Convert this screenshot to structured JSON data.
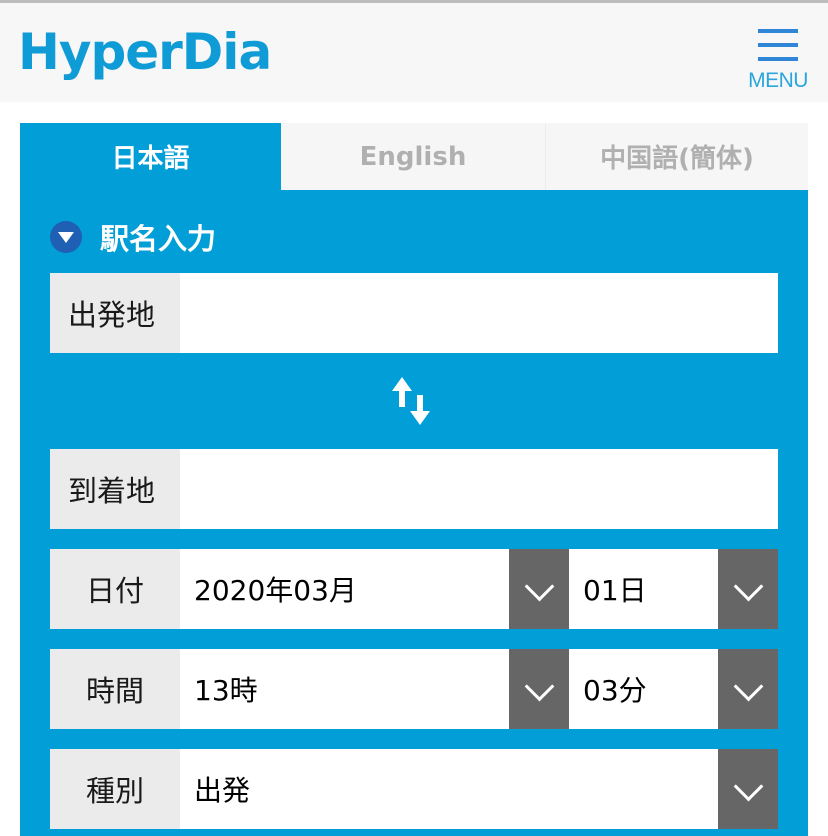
{
  "header": {
    "logo": "HyperDia",
    "menu_label": "MENU"
  },
  "tabs": [
    {
      "label": "日本語",
      "active": true
    },
    {
      "label": "English",
      "active": false
    },
    {
      "label": "中国語(簡体)",
      "active": false
    }
  ],
  "section": {
    "title": "駅名入力",
    "icon": "triangle-down-circle-icon"
  },
  "form": {
    "departure": {
      "label": "出発地",
      "value": "",
      "placeholder": ""
    },
    "swap_icon": "swap-arrows-icon",
    "arrival": {
      "label": "到着地",
      "value": "",
      "placeholder": ""
    },
    "date": {
      "label": "日付",
      "month_value": "2020年03月",
      "day_value": "01日"
    },
    "time": {
      "label": "時間",
      "hour_value": "13時",
      "minute_value": "03分"
    },
    "type": {
      "label": "種別",
      "value": "出発"
    }
  },
  "colors": {
    "brand": "#0f9bd6",
    "panel": "#029ed8",
    "dropdown_button": "#666666",
    "icon_circle": "#1f5fb4"
  }
}
